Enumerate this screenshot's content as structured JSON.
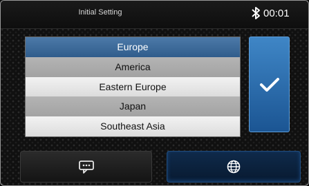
{
  "header": {
    "title": "Initial Setting",
    "time": "00:01",
    "bluetooth_icon": "bluetooth-icon"
  },
  "regions": [
    {
      "label": "Europe",
      "selected": true
    },
    {
      "label": "America",
      "selected": false
    },
    {
      "label": "Eastern Europe",
      "selected": false
    },
    {
      "label": "Japan",
      "selected": false
    },
    {
      "label": "Southeast Asia",
      "selected": false
    }
  ],
  "confirm_icon": "checkmark-icon",
  "bottom_bar": {
    "left_icon": "message-bubble-icon",
    "right_icon": "globe-icon"
  },
  "colors": {
    "selected": "#3d6c9d",
    "accent": "#2f78bd"
  }
}
